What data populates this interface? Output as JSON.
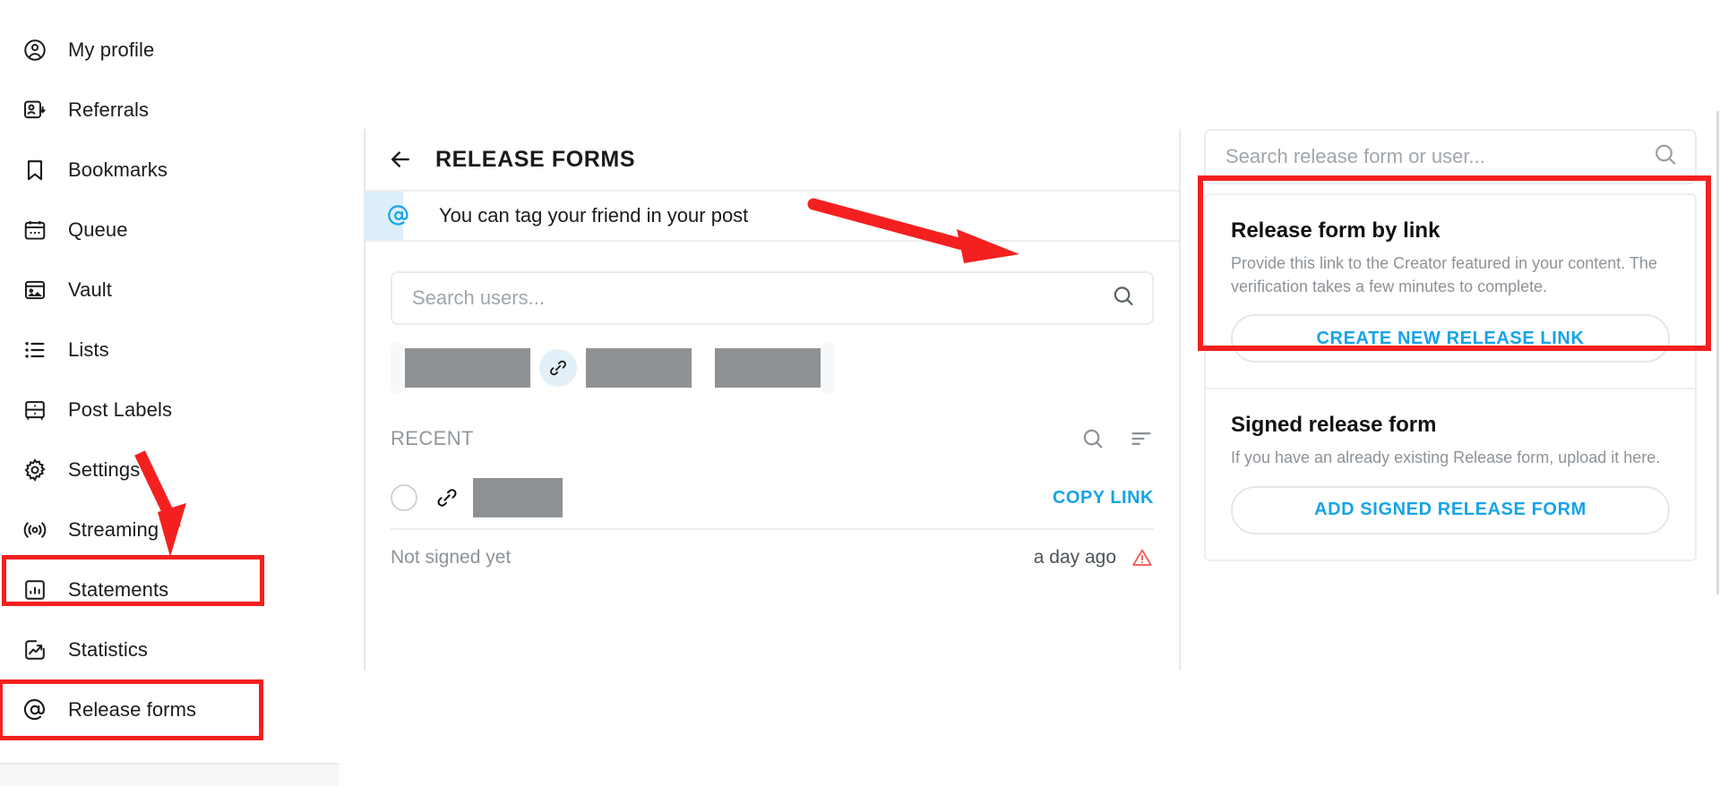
{
  "sidebar": {
    "items": [
      {
        "label": "My profile",
        "icon": "user-circle-icon"
      },
      {
        "label": "Referrals",
        "icon": "referrals-icon"
      },
      {
        "label": "Bookmarks",
        "icon": "bookmark-icon"
      },
      {
        "label": "Queue",
        "icon": "calendar-icon"
      },
      {
        "label": "Vault",
        "icon": "vault-image-icon"
      },
      {
        "label": "Lists",
        "icon": "lists-icon"
      },
      {
        "label": "Post Labels",
        "icon": "post-labels-icon"
      },
      {
        "label": "Settings",
        "icon": "gear-icon"
      },
      {
        "label": "Streaming",
        "icon": "broadcast-icon"
      },
      {
        "label": "Statements",
        "icon": "bar-chart-icon"
      },
      {
        "label": "Statistics",
        "icon": "trending-chart-icon"
      },
      {
        "label": "Release forms",
        "icon": "at-circle-icon"
      }
    ]
  },
  "main": {
    "back_icon": "back-arrow-icon",
    "title": "RELEASE FORMS",
    "tip": {
      "icon": "at-icon",
      "text": "You can tag your friend in your post"
    },
    "user_search": {
      "placeholder": "Search users...",
      "value": "",
      "icon": "search-icon"
    },
    "chips": {
      "link_icon": "link-icon",
      "redacted_count": 3
    },
    "recent": {
      "label": "RECENT",
      "search_icon": "search-icon",
      "sort_icon": "sort-icon"
    },
    "list_row": {
      "radio_icon": "radio-unchecked-icon",
      "link_icon": "link-icon",
      "copy_link_label": "COPY LINK",
      "status": "Not signed yet",
      "time": "a day ago",
      "warning_icon": "warning-triangle-icon"
    }
  },
  "right_panel": {
    "search": {
      "placeholder": "Search release form or user...",
      "value": "",
      "icon": "search-icon"
    },
    "sections": [
      {
        "title": "Release form by link",
        "description": "Provide this link to the Creator featured in your content. The verification takes a few minutes to complete.",
        "button_label": "CREATE NEW RELEASE LINK"
      },
      {
        "title": "Signed release form",
        "description": "If you have an already existing Release form, upload it here.",
        "button_label": "ADD SIGNED RELEASE FORM"
      }
    ]
  },
  "annotations": {
    "highlight_color": "#f42020",
    "accent_color": "#17a3e8"
  }
}
